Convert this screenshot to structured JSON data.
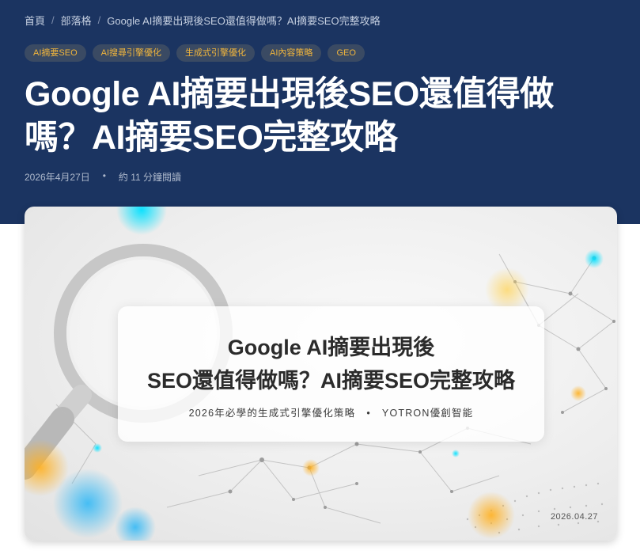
{
  "breadcrumb": {
    "home": "首頁",
    "blog": "部落格",
    "current": "Google AI摘要出現後SEO還值得做嗎？AI摘要SEO完整攻略",
    "separator": "/"
  },
  "tags": [
    "AI摘要SEO",
    "AI搜尋引擎優化",
    "生成式引擎優化",
    "AI內容策略",
    "GEO"
  ],
  "article": {
    "title_line1": "Google AI摘要出現後SEO還值得做",
    "title_line2": "嗎？AI摘要SEO完整攻略",
    "date": "2026年4月27日",
    "meta_sep": "•",
    "read_time": "約 11 分鐘閱讀"
  },
  "cover": {
    "line1": "Google AI摘要出現後",
    "line2": "SEO還值得做嗎？AI摘要SEO完整攻略",
    "subtitle_left": "2026年必學的生成式引擎優化策略",
    "subtitle_dot": "•",
    "subtitle_right": "YOTRON優創智能",
    "date": "2026.04.27"
  },
  "colors": {
    "hero_bg": "#1b3461",
    "tag_bg": "#3a4a63",
    "tag_text": "#f2b63c",
    "title_text": "#ffffff"
  }
}
